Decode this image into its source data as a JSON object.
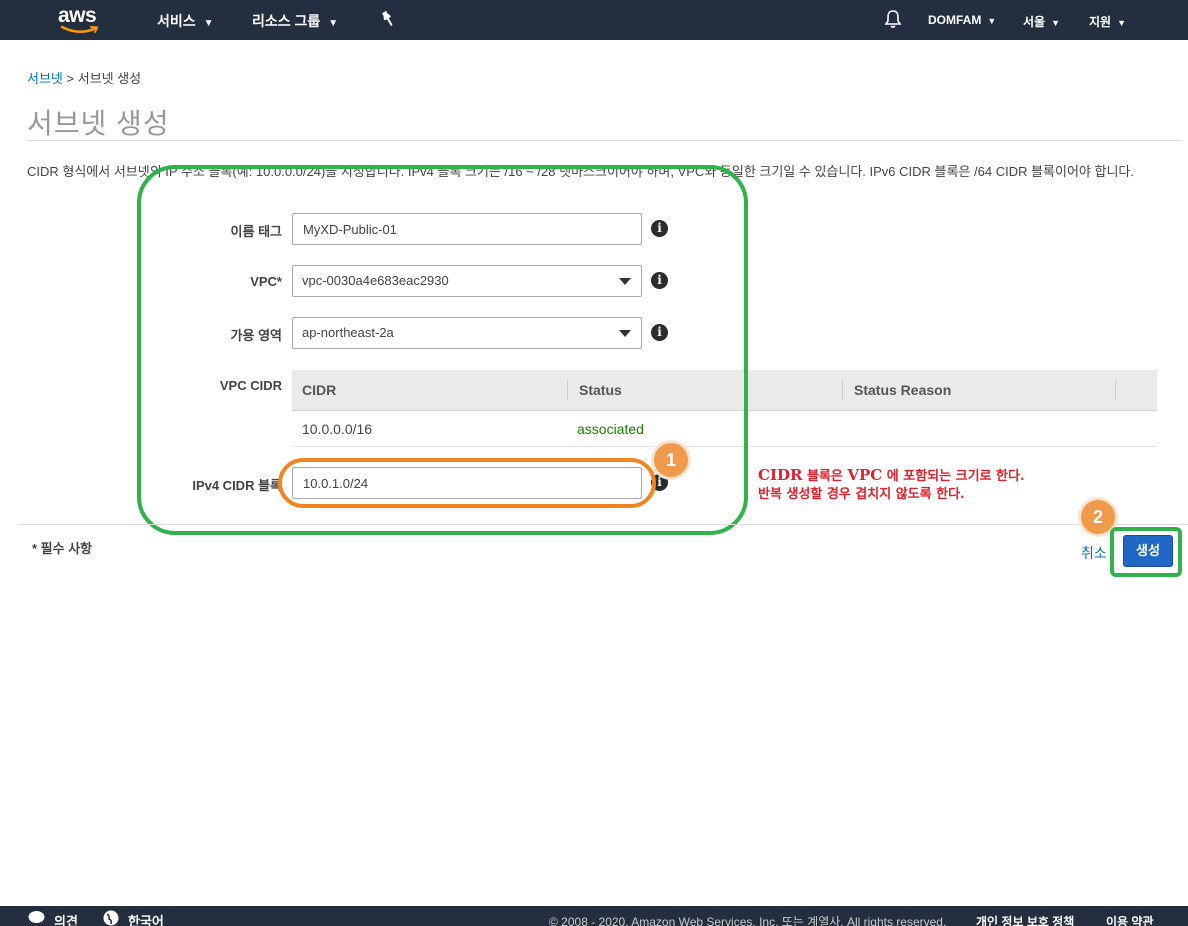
{
  "topbar": {
    "logo_text": "aws",
    "services_label": "서비스",
    "resource_groups_label": "리소스 그룹",
    "account_label": "DOMFAM",
    "region_label": "서울",
    "support_label": "지원"
  },
  "breadcrumb": {
    "parent": "서브넷",
    "separator": ">",
    "current": "서브넷 생성"
  },
  "page_title": "서브넷 생성",
  "description": "CIDR 형식에서 서브넷의 IP 주소 블록(예: 10.0.0.0/24)을 지정합니다. IPv4 블록 크기는 /16 ~ /28 넷마스크이어야 하며, VPC와 동일한 크기일 수 있습니다. IPv6 CIDR 블록은 /64 CIDR 블록이어야 합니다.",
  "form": {
    "name_tag_label": "이름 태그",
    "name_tag_value": "MyXD-Public-01",
    "vpc_label": "VPC*",
    "vpc_value": "vpc-0030a4e683eac2930",
    "az_label": "가용 영역",
    "az_value": "ap-northeast-2a",
    "vpc_cidr_label": "VPC CIDR",
    "ipv4_label": "IPv4 CIDR 블록",
    "ipv4_value": "10.0.1.0/24"
  },
  "cidr_table": {
    "columns": [
      "CIDR",
      "Status",
      "Status Reason"
    ],
    "rows": [
      {
        "cidr": "10.0.0.0/16",
        "status": "associated",
        "reason": ""
      }
    ],
    "status_color": "#1d8102"
  },
  "annotations": {
    "badge_1": "1",
    "badge_2": "2",
    "note_line1_a": "CIDR",
    "note_line1_b": " 블록은 ",
    "note_line1_c": "VPC",
    "note_line1_d": " 에 포함되는 크기로 한다.",
    "note_line2": "반복 생성할 경우 겹치지 않도록 한다.",
    "highlight_green": "#2fb34a",
    "highlight_orange": "#f48420",
    "note_color": "#e0202a"
  },
  "footer": {
    "required_note": "* 필수 사항",
    "cancel_label": "취소",
    "create_label": "생성"
  },
  "bottombar": {
    "feedback_label": "의견",
    "language_label": "한국어",
    "copyright": "© 2008 - 2020, Amazon Web Services, Inc. 또는 계열사. All rights reserved.",
    "privacy_label": "개인 정보 보호 정책",
    "terms_label": "이용 약관"
  }
}
